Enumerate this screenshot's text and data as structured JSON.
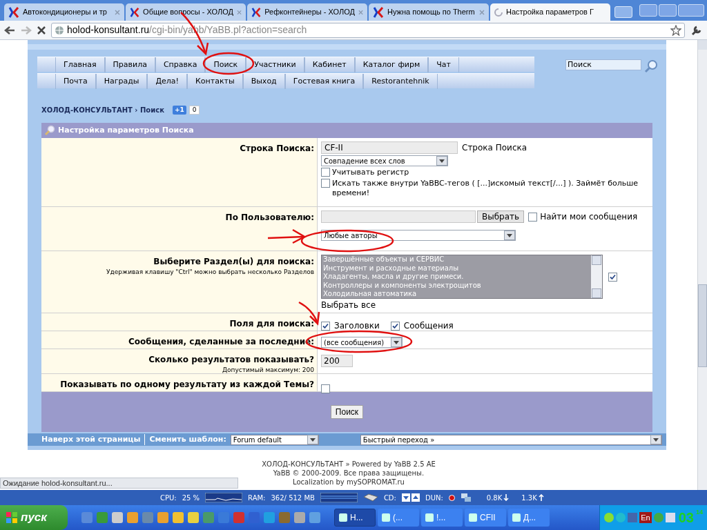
{
  "browser": {
    "tabs": [
      {
        "title": "Автокондиционеры и тр",
        "selected": false
      },
      {
        "title": "Общие вопросы - ХОЛОД",
        "selected": false
      },
      {
        "title": "Рефконтейнеры - ХОЛОД",
        "selected": false
      },
      {
        "title": "Нужна помощь по Therm",
        "selected": false
      },
      {
        "title": "Настройка параметров Г",
        "selected": true
      }
    ],
    "address": {
      "host": "holod-konsultant.ru",
      "path": "/cgi-bin/yabb/YaBB.pl?action=search"
    }
  },
  "nav": {
    "row_1": [
      "Главная",
      "Правила",
      "Справка",
      "Поиск",
      "Участники",
      "Кабинет",
      "Каталог фирм",
      "Чат"
    ],
    "row_2": [
      "Почта",
      "Награды",
      "Дела!",
      "Контакты",
      "Выход",
      "Гостевая книга",
      "Restorantehnik"
    ],
    "search_value": "Поиск"
  },
  "breadcrumb": {
    "site": "ХОЛОД-КОНСУЛЬТАНТ",
    "separator": "›",
    "page": "Поиск"
  },
  "plusone": {
    "label": "+1",
    "count": "0"
  },
  "panel_title": "Настройка параметров Поиска",
  "rows": [
    {
      "kind": "search",
      "label": "Строка Поиска:",
      "value": "CF-II",
      "hint": "Строка Поиска",
      "match": "Совпадение всех слов",
      "options": [
        {
          "label": "Учитывать регистр",
          "checked": false
        },
        {
          "label": "Искать также внутри YaBBC-тегов ( [...]искомый текст[/...] ). Займёт больше времени!",
          "checked": false
        }
      ]
    },
    {
      "kind": "user",
      "label": "По Пользователю:",
      "button": "Выбрать",
      "option": {
        "label": "Найти мои сообщения",
        "checked": false
      },
      "authors": "Любые авторы"
    },
    {
      "kind": "boards",
      "label": "Выберите Раздел(ы) для поиска:",
      "note": "Удерживая клавишу \"Ctrl\" можно выбрать несколько Разделов",
      "boards": [
        "Завершённые объекты и СЕРВИС",
        "Инструмент и расходные материалы",
        "Хладагенты, масла и другие примеси.",
        "Контроллеры и компоненты электрощитов",
        "Холодильная автоматика"
      ],
      "all_checked": true,
      "select_all": "Выбрать все"
    },
    {
      "kind": "fields",
      "label": "Поля для поиска:",
      "fields": [
        {
          "label": "Заголовки",
          "checked": true
        },
        {
          "label": "Сообщения",
          "checked": true
        }
      ]
    },
    {
      "kind": "select",
      "label": "Сообщения, сделанные за последние:",
      "value": "(все сообщения)"
    },
    {
      "kind": "number",
      "label": "Сколько результатов показывать?",
      "note": "Допустимый максимум: 200",
      "value": "200"
    },
    {
      "kind": "checkbox",
      "label": "Показывать по одному результату из каждой Темы?",
      "checked": false
    }
  ],
  "submit": "Поиск",
  "bottom_bar": {
    "top_link": "Наверх этой страницы",
    "template_label": "Сменить шаблон:",
    "template": "Forum default",
    "jump": "Быстрый переход »"
  },
  "footer": [
    "ХОЛОД-КОНСУЛЬТАНТ » Powered by YaBB 2.5 AE",
    "YaBB © 2000-2009. Все права защищены.",
    "Localization by mySOPROMAT.ru"
  ],
  "status": "Ожидание holod-konsultant.ru...",
  "monitor": {
    "cpu_label": "CPU:",
    "cpu": "25 %",
    "ram_label": "RAM:",
    "ram": "362/ 512 MB",
    "cd": "CD:",
    "dun": "DUN:",
    "down": "0.8K",
    "up": "1.3K"
  },
  "taskbar": {
    "start": "пуск",
    "windows": [
      {
        "label": "Н...",
        "selected": true
      },
      {
        "label": "(...",
        "selected": false
      },
      {
        "label": "!...",
        "selected": false
      },
      {
        "label": "CFII",
        "selected": false
      },
      {
        "label": "Д...",
        "selected": false
      }
    ],
    "lang": "En",
    "clock": "03",
    "clock_small": "14"
  }
}
